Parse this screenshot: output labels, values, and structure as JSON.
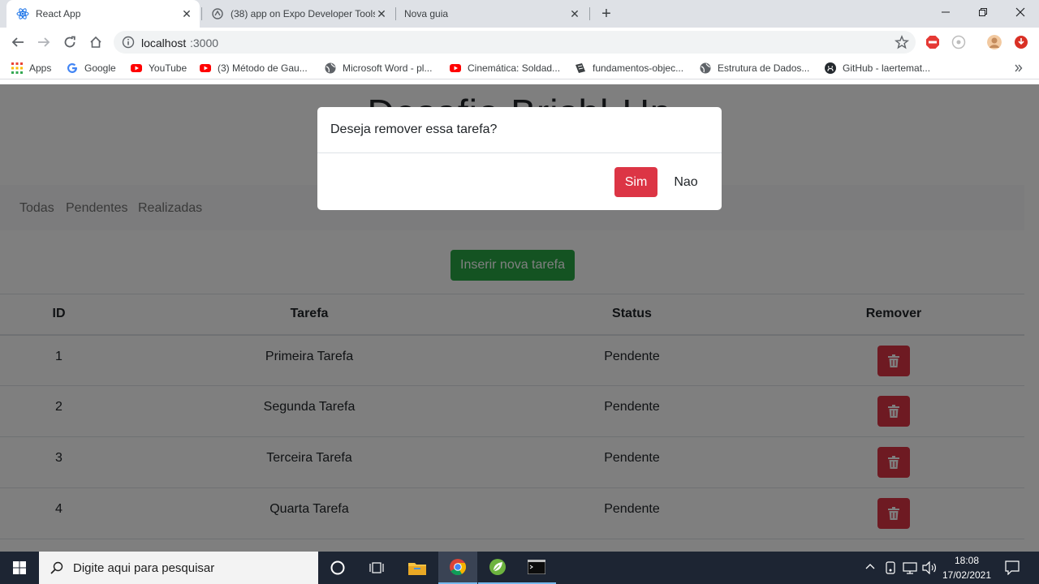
{
  "browser": {
    "tabs": [
      {
        "title": "React App",
        "close": "✕"
      },
      {
        "title": "(38) app on Expo Developer Tools",
        "close": "✕"
      },
      {
        "title": "Nova guia",
        "close": "✕"
      }
    ],
    "new_tab": "+",
    "url_host": "localhost",
    "url_port": ":3000",
    "bookmarks": [
      {
        "label": "Apps",
        "icon": "apps-grid-icon"
      },
      {
        "label": "Google",
        "icon": "google-icon"
      },
      {
        "label": "YouTube",
        "icon": "youtube-icon"
      },
      {
        "label": "(3) Método de Gau...",
        "icon": "youtube-icon"
      },
      {
        "label": "Microsoft Word - pl...",
        "icon": "globe-icon"
      },
      {
        "label": "Cinemática: Soldad...",
        "icon": "youtube-icon"
      },
      {
        "label": "fundamentos-objec...",
        "icon": "document-icon"
      },
      {
        "label": "Estrutura de Dados...",
        "icon": "globe-icon"
      },
      {
        "label": "GitHub - laertemat...",
        "icon": "github-icon"
      }
    ]
  },
  "app": {
    "title": "Desafio Brishl-Up",
    "filters": [
      "Todas",
      "Pendentes",
      "Realizadas"
    ],
    "insert_button": "Inserir nova tarefa",
    "table": {
      "headers": [
        "ID",
        "Tarefa",
        "Status",
        "Remover"
      ],
      "rows": [
        {
          "id": "1",
          "task": "Primeira Tarefa",
          "status": "Pendente"
        },
        {
          "id": "2",
          "task": "Segunda Tarefa",
          "status": "Pendente"
        },
        {
          "id": "3",
          "task": "Terceira Tarefa",
          "status": "Pendente"
        },
        {
          "id": "4",
          "task": "Quarta Tarefa",
          "status": "Pendente"
        }
      ]
    }
  },
  "modal": {
    "message": "Deseja remover essa tarefa?",
    "confirm": "Sim",
    "cancel": "Nao"
  },
  "taskbar": {
    "search_placeholder": "Digite aqui para pesquisar",
    "time": "18:08",
    "date": "17/02/2021"
  },
  "colors": {
    "danger": "#dc3545",
    "success": "#28a745",
    "taskbar": "#1d2533"
  }
}
